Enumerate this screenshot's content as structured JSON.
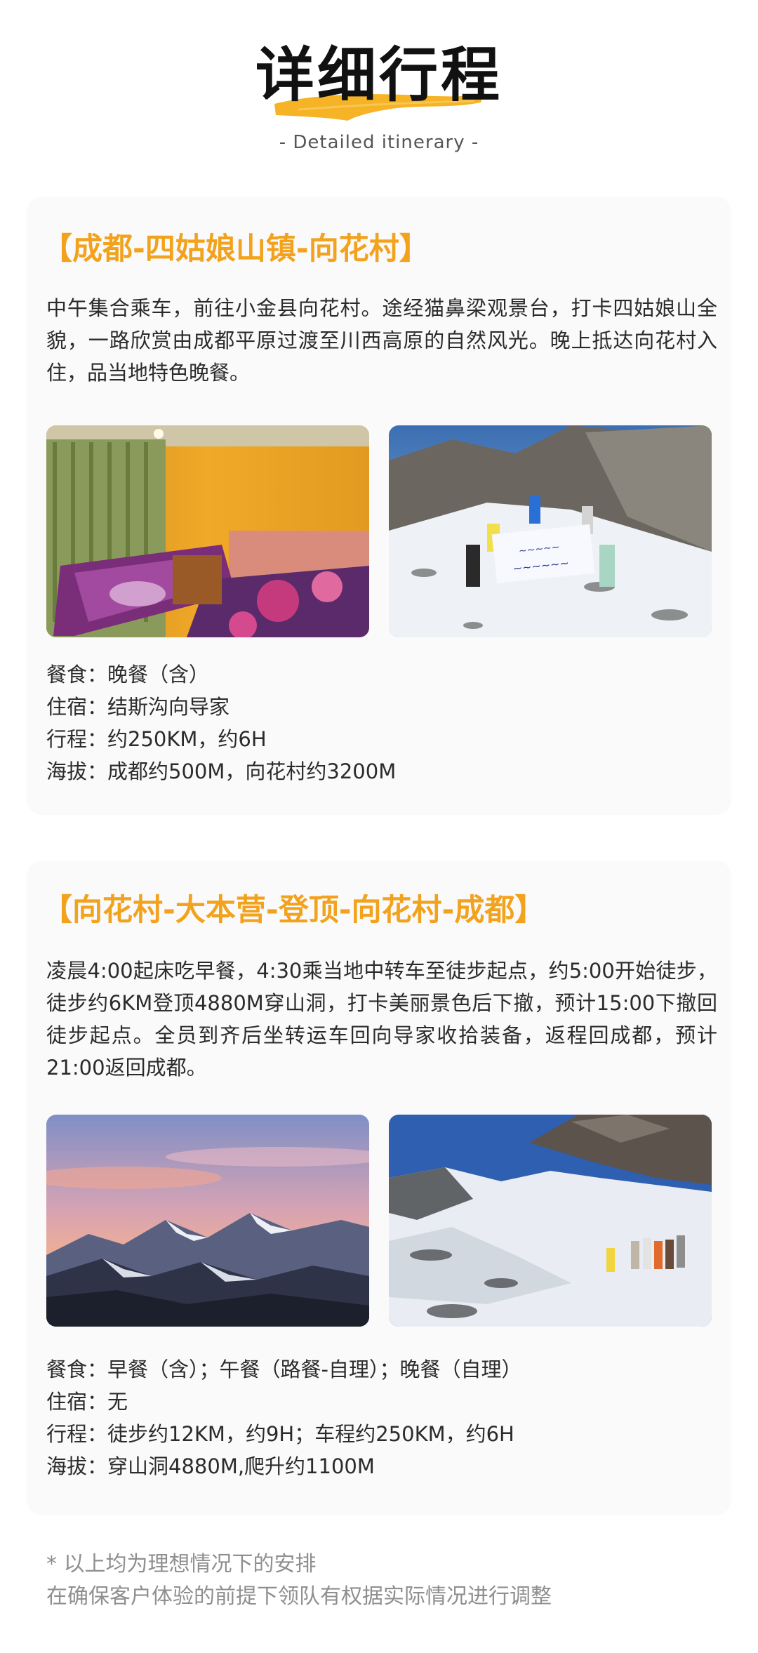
{
  "header": {
    "title": "详细行程",
    "subtitle": "- Detailed itinerary -"
  },
  "days": [
    {
      "title": "【成都-四姑娘山镇-向花村】",
      "description": "中午集合乘车，前往小金县向花村。途经猫鼻梁观景台，打卡四姑娘山全貌，一路欣赏由成都平原过渡至川西高原的自然风光。晚上抵达向花村入住，品当地特色晚餐。",
      "photos": [
        {
          "icon": "guesthouse-room-photo"
        },
        {
          "icon": "group-banner-snow-photo"
        }
      ],
      "info": [
        {
          "label": "餐食：",
          "value": "晚餐（含）"
        },
        {
          "label": "住宿：",
          "value": "结斯沟向导家"
        },
        {
          "label": "行程：",
          "value": "约250KM，约6H"
        },
        {
          "label": "海拔：",
          "value": "成都约500M，向花村约3200M"
        }
      ]
    },
    {
      "title": "【向花村-大本营-登顶-向花村-成都】",
      "description": "凌晨4:00起床吃早餐，4:30乘当地中转车至徒步起点，约5:00开始徒步，徒步约6KM登顶4880M穿山洞，打卡美丽景色后下撤，预计15:00下撤回徒步起点。全员到齐后坐转运车回向导家收拾装备，返程回成都，预计21:00返回成都。",
      "photos": [
        {
          "icon": "sunrise-mountains-photo"
        },
        {
          "icon": "snow-slope-hikers-photo"
        }
      ],
      "info": [
        {
          "label": "餐食：",
          "value": "早餐（含）；午餐（路餐-自理）；晚餐（自理）"
        },
        {
          "label": "住宿：",
          "value": "无"
        },
        {
          "label": "行程：",
          "value": "徒步约12KM，约9H；车程约250KM，约6H"
        },
        {
          "label": "海拔：",
          "value": "穿山洞4880M,爬升约1100M"
        }
      ]
    }
  ],
  "footer": {
    "line1": "* 以上均为理想情况下的安排",
    "line2": "在确保客户体验的前提下领队有权据实际情况进行调整"
  },
  "colors": {
    "accent": "#f2a21c",
    "brush": "#f5b325",
    "card_bg": "#fafafa",
    "text": "#2b2b2b",
    "muted": "#8f8f8f"
  }
}
